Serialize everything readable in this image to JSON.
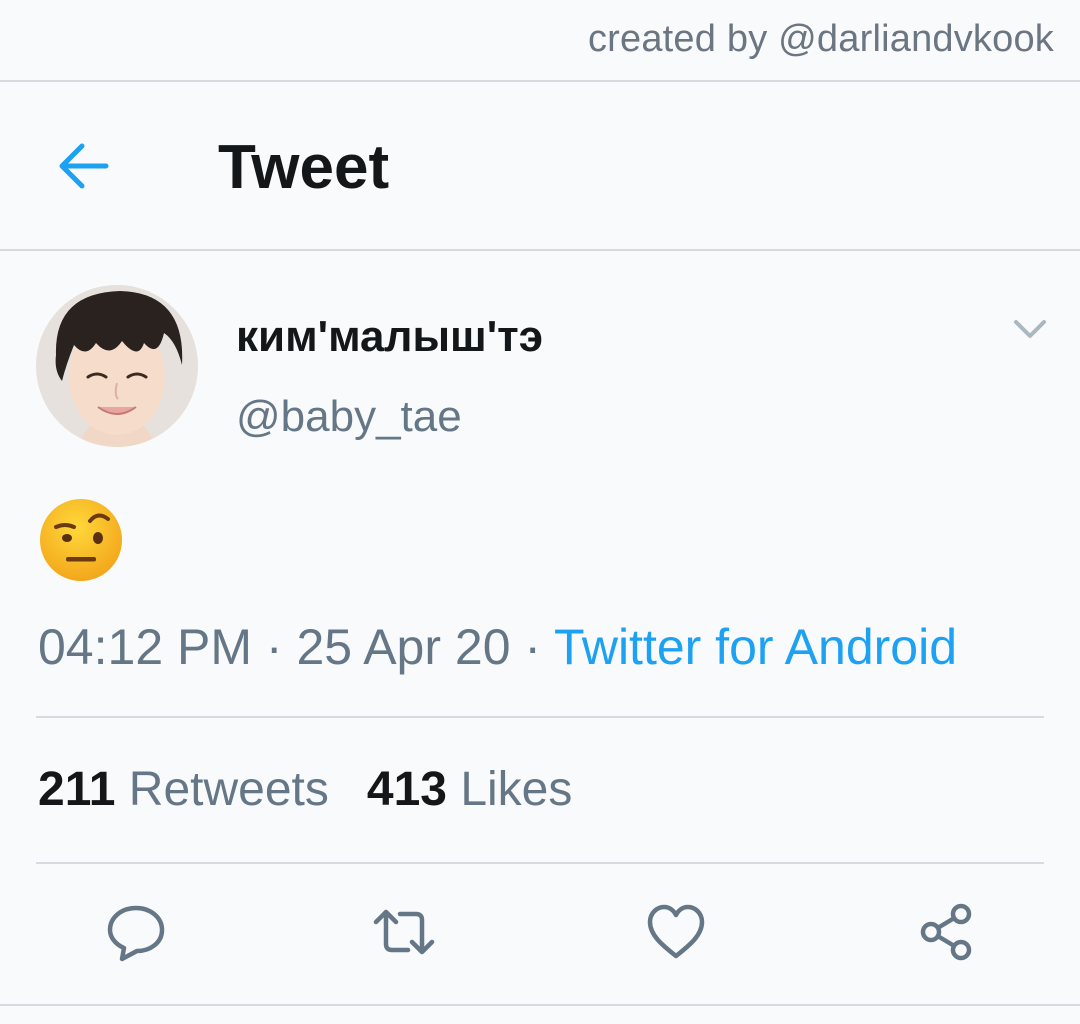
{
  "watermark": "created by @darliandvkook",
  "header": {
    "back_icon": "back-arrow-icon",
    "title": "Tweet"
  },
  "tweet": {
    "display_name": "ким'малыш'тэ",
    "handle": "@baby_tae",
    "content_emoji": "face-with-raised-eyebrow",
    "time": "04:12 PM",
    "separator": " · ",
    "date": "25 Apr 20",
    "source": "Twitter for Android",
    "retweets_count": "211",
    "retweets_label": "Retweets",
    "likes_count": "413",
    "likes_label": "Likes"
  },
  "actions": [
    "reply-icon",
    "retweet-icon",
    "like-icon",
    "share-icon"
  ],
  "colors": {
    "accent": "#1da1f2",
    "secondary_text": "#657786",
    "primary_text": "#14171a",
    "divider": "#d5dbe0",
    "background": "#f9fafb"
  }
}
